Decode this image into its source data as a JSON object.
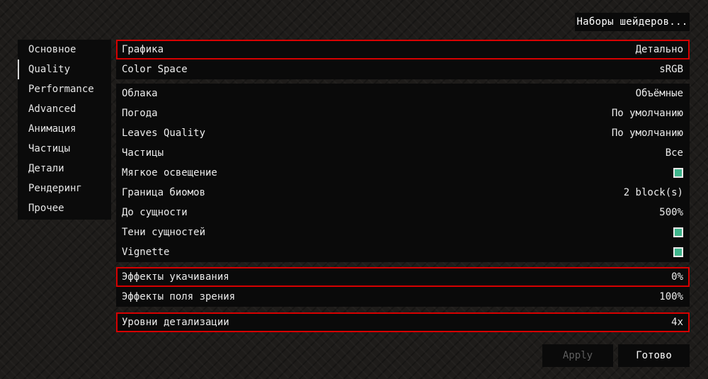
{
  "header": {
    "shader_packs_label": "Наборы шейдеров..."
  },
  "sidebar": {
    "items": [
      {
        "label": "Основное"
      },
      {
        "label": "Quality"
      },
      {
        "label": "Performance"
      },
      {
        "label": "Advanced"
      },
      {
        "label": "Анимация"
      },
      {
        "label": "Частицы"
      },
      {
        "label": "Детали"
      },
      {
        "label": "Рендеринг"
      },
      {
        "label": "Прочее"
      }
    ],
    "active_index": 1
  },
  "settings": {
    "group1": [
      {
        "label": "Графика",
        "value": "Детально",
        "highlighted": true
      },
      {
        "label": "Color Space",
        "value": "sRGB"
      }
    ],
    "group2": [
      {
        "label": "Облака",
        "value": "Объёмные"
      },
      {
        "label": "Погода",
        "value": "По умолчанию"
      },
      {
        "label": "Leaves Quality",
        "value": "По умолчанию"
      },
      {
        "label": "Частицы",
        "value": "Все"
      },
      {
        "label": "Мягкое освещение",
        "checked": true
      },
      {
        "label": "Граница биомов",
        "value": "2 block(s)"
      },
      {
        "label": "До сущности",
        "value": "500%"
      },
      {
        "label": "Тени сущностей",
        "checked": true
      },
      {
        "label": "Vignette",
        "checked": true
      }
    ],
    "group3": [
      {
        "label": "Эффекты укачивания",
        "value": "0%",
        "highlighted": true
      },
      {
        "label": "Эффекты поля зрения",
        "value": "100%"
      }
    ],
    "group4": [
      {
        "label": "Уровни детализации",
        "value": "4x",
        "highlighted": true
      }
    ]
  },
  "footer": {
    "apply_label": "Apply",
    "done_label": "Готово"
  },
  "colors": {
    "highlight": "#d60000",
    "checkbox": "#3fb58c"
  }
}
